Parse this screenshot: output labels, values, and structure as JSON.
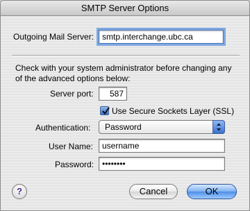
{
  "window": {
    "title": "SMTP Server Options"
  },
  "outgoing_mail_server": {
    "label": "Outgoing Mail Server:",
    "value": "smtp.interchange.ubc.ca"
  },
  "note": "Check with your system administrator before changing any of the advanced options below:",
  "server_port": {
    "label": "Server port:",
    "value": "587"
  },
  "ssl": {
    "label": "Use Secure Sockets Layer (SSL)",
    "checked": true
  },
  "authentication": {
    "label": "Authentication:",
    "selected": "Password"
  },
  "user_name": {
    "label": "User Name:",
    "value": "username"
  },
  "password": {
    "label": "Password:",
    "value": "••••••••"
  },
  "buttons": {
    "help": "?",
    "cancel": "Cancel",
    "ok": "OK"
  },
  "colors": {
    "accent": "#3a70cf",
    "focus_ring": "#7ea8e0"
  }
}
